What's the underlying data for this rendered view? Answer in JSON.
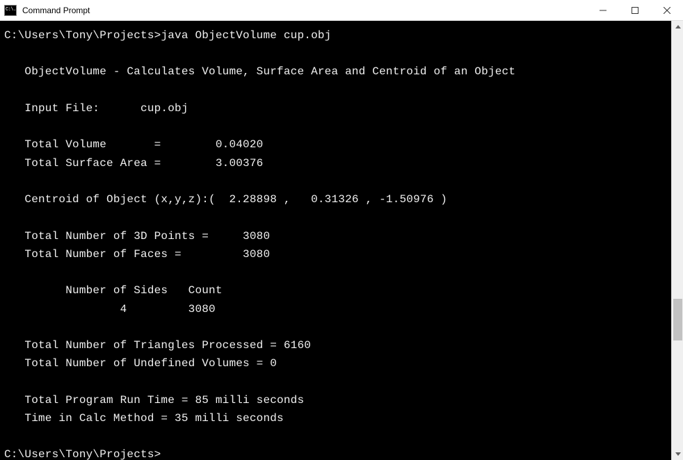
{
  "window": {
    "title": "Command Prompt",
    "icon_text": "C:\\."
  },
  "terminal": {
    "prompt_path": "C:\\Users\\Tony\\Projects>",
    "command": "java ObjectVolume cup.obj",
    "header": "   ObjectVolume - Calculates Volume, Surface Area and Centroid of an Object",
    "input_file_label": "   Input File:      cup.obj",
    "total_volume": "   Total Volume       =        0.04020",
    "total_surface_area": "   Total Surface Area =        3.00376",
    "centroid": "   Centroid of Object (x,y,z):(  2.28898 ,   0.31326 , -1.50976 )",
    "points_line": "   Total Number of 3D Points =     3080",
    "faces_line": "   Total Number of Faces =         3080",
    "sides_header": "         Number of Sides   Count",
    "sides_row": "                 4         3080",
    "triangles_line": "   Total Number of Triangles Processed = 6160",
    "undef_line": "   Total Number of Undefined Volumes = 0",
    "runtime_line": "   Total Program Run Time = 85 milli seconds",
    "calc_line": "   Time in Calc Method = 35 milli seconds",
    "final_prompt": "C:\\Users\\Tony\\Projects>"
  }
}
